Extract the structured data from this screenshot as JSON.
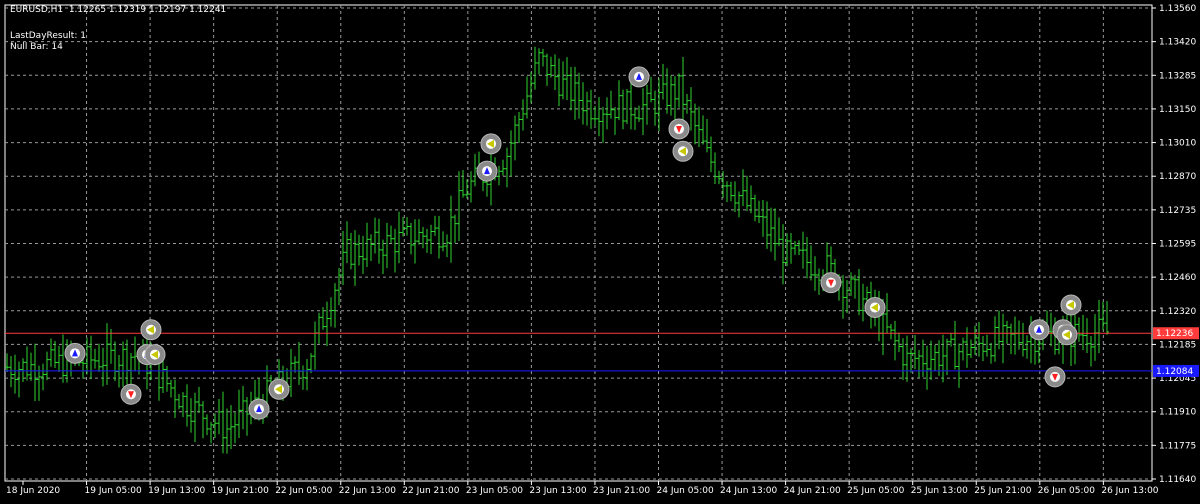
{
  "header": {
    "symbol_line": "EURUSD,H1  1.12265 1.12319 1.12197 1.12241",
    "last_day_result": "LastDayResult: 1",
    "null_bar": "Null Bar: 14"
  },
  "colors": {
    "background": "#000000",
    "grid": "#9a9a9a",
    "candle": "#2fd32f",
    "axis_text": "#ffffff",
    "red_line": "#ff3b3b",
    "blue_line": "#1a1aff"
  },
  "chart_data": {
    "type": "ohlc",
    "grid": true,
    "ylim": [
      1.1164,
      1.1356
    ],
    "y_ticks": [
      "1.13560",
      "1.13420",
      "1.13285",
      "1.13150",
      "1.13010",
      "1.12870",
      "1.12735",
      "1.12595",
      "1.12460",
      "1.12320",
      "1.12185",
      "1.12045",
      "1.11910",
      "1.11775",
      "1.11640"
    ],
    "x_ticks": [
      "18 Jun 2020",
      "19 Jun 05:00",
      "19 Jun 13:00",
      "19 Jun 21:00",
      "22 Jun 05:00",
      "22 Jun 13:00",
      "22 Jun 21:00",
      "23 Jun 05:00",
      "23 Jun 13:00",
      "23 Jun 21:00",
      "24 Jun 05:00",
      "24 Jun 13:00",
      "24 Jun 21:00",
      "25 Jun 05:00",
      "25 Jun 13:00",
      "25 Jun 21:00",
      "26 Jun 05:00",
      "26 Jun 13:00"
    ],
    "horizontal_lines": [
      {
        "price": 1.12236,
        "label": "1.12236",
        "color": "#ff3b3b"
      },
      {
        "price": 1.12084,
        "label": "1.12084",
        "color": "#1a1aff"
      }
    ],
    "anchors": [
      {
        "bar": 5,
        "price": 1.121
      },
      {
        "bar": 33,
        "price": 1.1215
      },
      {
        "bar": 45,
        "price": 1.1195
      },
      {
        "bar": 55,
        "price": 1.1185
      },
      {
        "bar": 75,
        "price": 1.1212
      },
      {
        "bar": 85,
        "price": 1.1256
      },
      {
        "bar": 100,
        "price": 1.1262
      },
      {
        "bar": 110,
        "price": 1.1265
      },
      {
        "bar": 115,
        "price": 1.1282
      },
      {
        "bar": 125,
        "price": 1.1296
      },
      {
        "bar": 133,
        "price": 1.1334
      },
      {
        "bar": 140,
        "price": 1.1322
      },
      {
        "bar": 146,
        "price": 1.1315
      },
      {
        "bar": 160,
        "price": 1.1315
      },
      {
        "bar": 168,
        "price": 1.1322
      },
      {
        "bar": 175,
        "price": 1.1295
      },
      {
        "bar": 185,
        "price": 1.1275
      },
      {
        "bar": 195,
        "price": 1.1255
      },
      {
        "bar": 205,
        "price": 1.125
      },
      {
        "bar": 215,
        "price": 1.1235
      },
      {
        "bar": 225,
        "price": 1.1213
      },
      {
        "bar": 235,
        "price": 1.1215
      },
      {
        "bar": 245,
        "price": 1.122
      },
      {
        "bar": 255,
        "price": 1.1222
      },
      {
        "bar": 265,
        "price": 1.1223
      },
      {
        "bar": 272,
        "price": 1.1224
      }
    ],
    "signals": [
      {
        "bar": 17,
        "price": 1.12155,
        "dir": "buy"
      },
      {
        "bar": 31,
        "price": 1.1199,
        "dir": "sell"
      },
      {
        "bar": 35,
        "price": 1.1215,
        "dir": "buy"
      },
      {
        "bar": 36,
        "price": 1.1225,
        "dir": "close"
      },
      {
        "bar": 37,
        "price": 1.1215,
        "dir": "close"
      },
      {
        "bar": 63,
        "price": 1.1193,
        "dir": "buy"
      },
      {
        "bar": 68,
        "price": 1.1201,
        "dir": "close"
      },
      {
        "bar": 120,
        "price": 1.1289,
        "dir": "buy"
      },
      {
        "bar": 121,
        "price": 1.13,
        "dir": "close"
      },
      {
        "bar": 158,
        "price": 1.1327,
        "dir": "buy"
      },
      {
        "bar": 168,
        "price": 1.1306,
        "dir": "sell"
      },
      {
        "bar": 169,
        "price": 1.1297,
        "dir": "close"
      },
      {
        "bar": 206,
        "price": 1.1244,
        "dir": "sell"
      },
      {
        "bar": 217,
        "price": 1.1234,
        "dir": "close"
      },
      {
        "bar": 258,
        "price": 1.1225,
        "dir": "buy"
      },
      {
        "bar": 264,
        "price": 1.1225,
        "dir": "buy"
      },
      {
        "bar": 265,
        "price": 1.1223,
        "dir": "close"
      },
      {
        "bar": 262,
        "price": 1.1206,
        "dir": "sell"
      },
      {
        "bar": 266,
        "price": 1.1235,
        "dir": "close"
      }
    ]
  }
}
